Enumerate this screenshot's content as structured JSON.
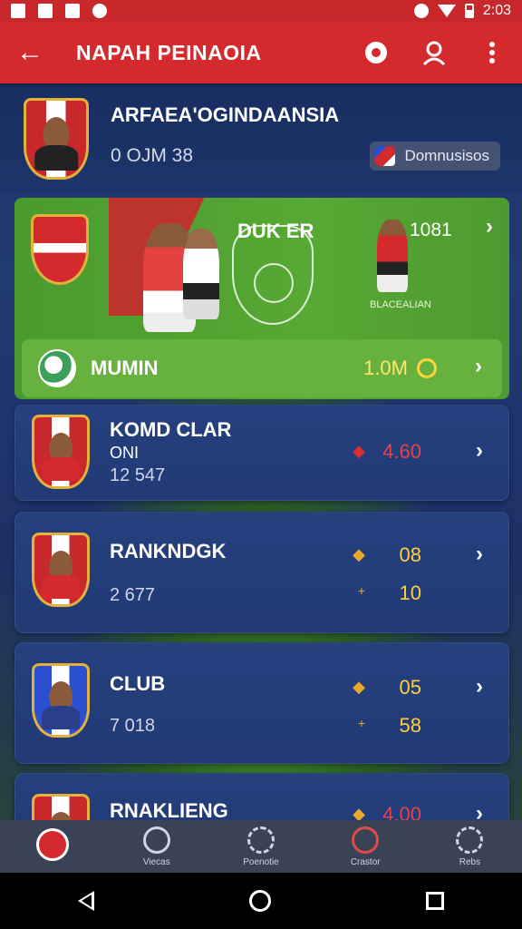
{
  "status_bar": {
    "time": "2:03"
  },
  "app_bar": {
    "title": "NAPAH PEINAOIA",
    "back_label": "←"
  },
  "profile": {
    "name": "ARFAEA'OGINDAANSIA",
    "stats": "0 OJM 38",
    "badge_label": "Domnusisos"
  },
  "featured": {
    "title": "DUK ER",
    "number": "1081",
    "caption": "BLACEALIAN",
    "bar_label": "MUMIN",
    "bar_value": "1.0M"
  },
  "cards": [
    {
      "title": "KOMD CLAR",
      "subtitle": "ONI",
      "meta": "12 547",
      "value": "4.60",
      "value_color": "red"
    },
    {
      "title": "RANKNDGK",
      "meta": "2 677",
      "value": "08",
      "value2": "10"
    },
    {
      "title": "CLUB",
      "meta": "7 018",
      "value": "05",
      "value2": "58"
    },
    {
      "title": "RNAKLIENG",
      "value": "4.00"
    }
  ],
  "bottom_nav": [
    {
      "label": "",
      "icon": "home-icon"
    },
    {
      "label": "Viecas",
      "icon": "compass-icon"
    },
    {
      "label": "Poenotie",
      "icon": "gear-icon"
    },
    {
      "label": "Crastor",
      "icon": "search-icon"
    },
    {
      "label": "Rebs",
      "icon": "gear-icon"
    }
  ],
  "colors": {
    "primary": "#d42a2e",
    "card": "#26407f",
    "accent": "#ffcf3a",
    "green": "#57a834"
  }
}
